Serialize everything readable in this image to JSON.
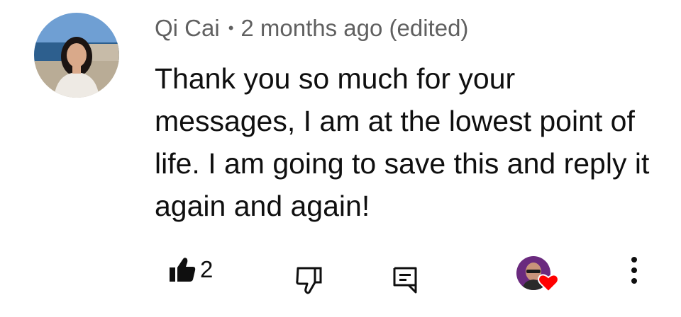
{
  "comment": {
    "author": "Qi Cai",
    "separator": "•",
    "timestamp": "2 months ago (edited)",
    "text": "Thank you so much for your messages, I am at the lowest point of life. I am going to save this and reply it again and again!",
    "avatar_icon": "user-avatar-photo"
  },
  "actions": {
    "like_count": "2",
    "like_icon": "thumbs-up-filled-icon",
    "dislike_icon": "thumbs-down-outline-icon",
    "reply_icon": "reply-comment-icon",
    "creator_heart_icon": "creator-heart-icon",
    "more_icon": "more-vertical-icon"
  },
  "colors": {
    "text_primary": "#0f0f0f",
    "text_secondary": "#606060",
    "heart_red": "#ff0000"
  }
}
